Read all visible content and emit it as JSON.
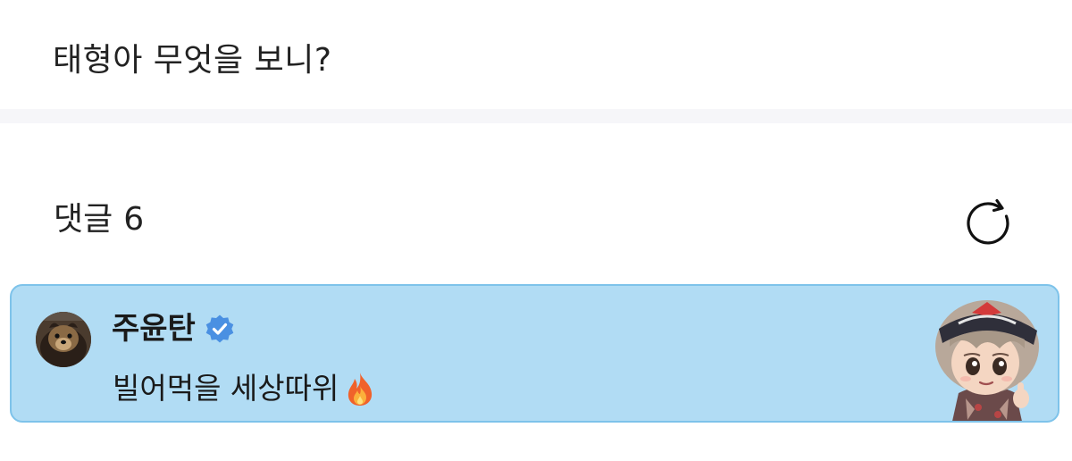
{
  "post": {
    "text": "태형아 무엇을 보니?"
  },
  "comments": {
    "title": "댓글",
    "count": "6",
    "refresh_icon": "refresh-icon"
  },
  "comment": {
    "username": "주윤탄",
    "verified_icon": "verified-badge-icon",
    "text": "빌어먹을 세상따위",
    "emoji_icon": "fire-emoji-icon",
    "avatar_icon": "dog-avatar",
    "sticker_icon": "character-sticker",
    "highlight_color": "#b1dcf4"
  }
}
